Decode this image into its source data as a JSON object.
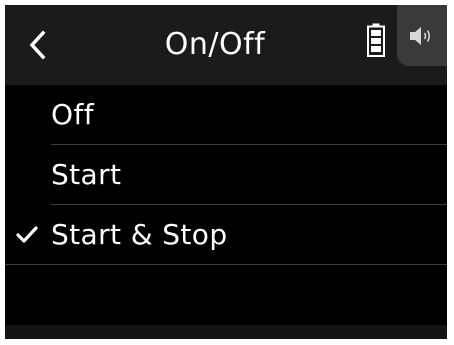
{
  "header": {
    "title": "On/Off",
    "back_icon": "chevron-left-icon",
    "battery_icon": "battery-full-icon",
    "speaker_icon": "speaker-icon"
  },
  "options": [
    {
      "label": "Off",
      "selected": false
    },
    {
      "label": "Start",
      "selected": false
    },
    {
      "label": "Start & Stop",
      "selected": true
    }
  ],
  "colors": {
    "background": "#000000",
    "header": "#1b1b1b",
    "text": "#ffffff",
    "divider": "#3d3d3d",
    "speaker_button": "#3a3a3a"
  }
}
